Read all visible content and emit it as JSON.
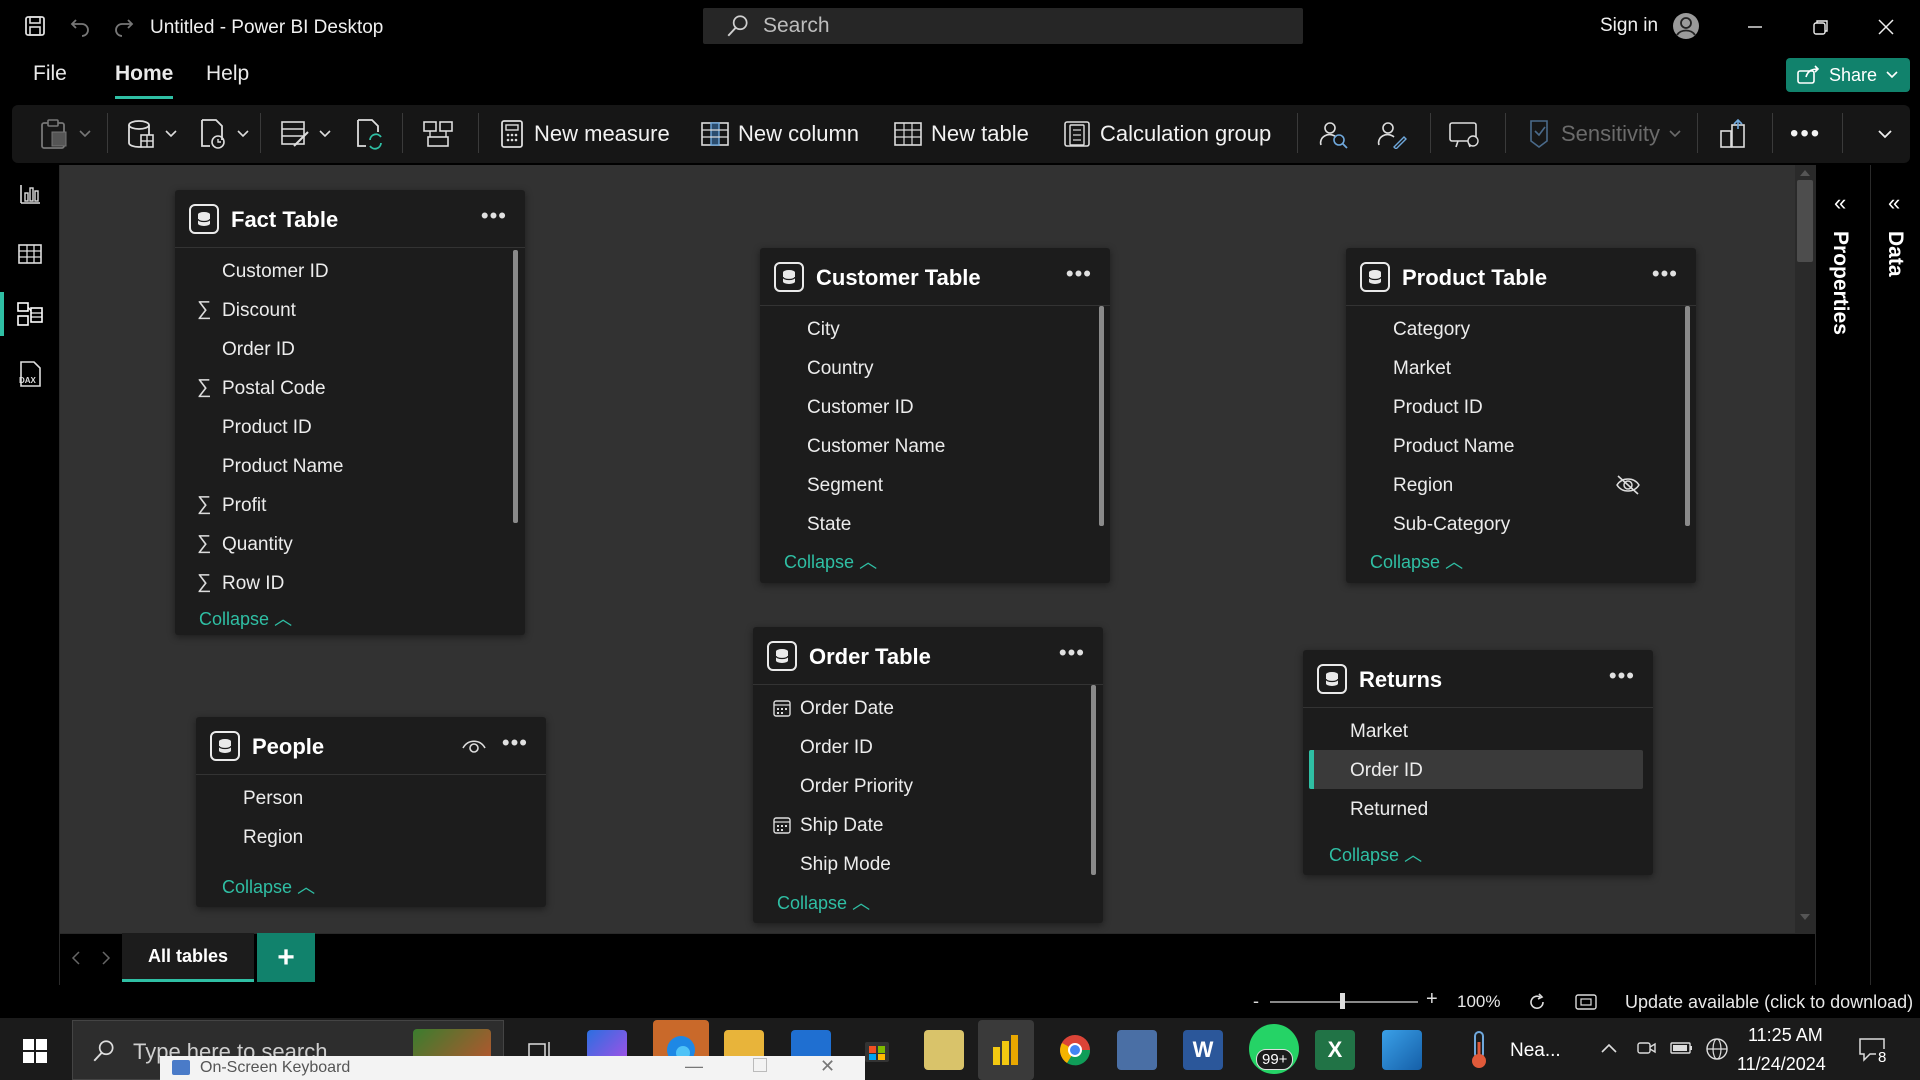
{
  "titlebar": {
    "title": "Untitled - Power BI Desktop",
    "search_placeholder": "Search",
    "sign_in": "Sign in"
  },
  "menu": {
    "file": "File",
    "home": "Home",
    "help": "Help",
    "share": "Share"
  },
  "ribbon": {
    "new_measure": "New measure",
    "new_column": "New column",
    "new_table": "New table",
    "calculation_group": "Calculation group",
    "sensitivity": "Sensitivity"
  },
  "right_panes": {
    "properties": "Properties",
    "data": "Data"
  },
  "tables": {
    "fact": {
      "title": "Fact Table",
      "fields": [
        {
          "name": "Customer ID",
          "sum": false
        },
        {
          "name": "Discount",
          "sum": true
        },
        {
          "name": "Order ID",
          "sum": false
        },
        {
          "name": "Postal Code",
          "sum": true
        },
        {
          "name": "Product ID",
          "sum": false
        },
        {
          "name": "Product Name",
          "sum": false
        },
        {
          "name": "Profit",
          "sum": true
        },
        {
          "name": "Quantity",
          "sum": true
        },
        {
          "name": "Row ID",
          "sum": true
        }
      ],
      "collapse": "Collapse"
    },
    "customer": {
      "title": "Customer Table",
      "fields": [
        "City",
        "Country",
        "Customer ID",
        "Customer Name",
        "Segment",
        "State"
      ],
      "collapse": "Collapse"
    },
    "product": {
      "title": "Product Table",
      "fields": [
        "Category",
        "Market",
        "Product ID",
        "Product Name",
        "Region",
        "Sub-Category"
      ],
      "hidden_field": "Region",
      "collapse": "Collapse"
    },
    "people": {
      "title": "People",
      "fields": [
        "Person",
        "Region"
      ],
      "collapse": "Collapse"
    },
    "order": {
      "title": "Order Table",
      "fields": [
        {
          "name": "Order Date",
          "date": true
        },
        {
          "name": "Order ID",
          "date": false
        },
        {
          "name": "Order Priority",
          "date": false
        },
        {
          "name": "Ship Date",
          "date": true
        },
        {
          "name": "Ship Mode",
          "date": false
        }
      ],
      "collapse": "Collapse"
    },
    "returns": {
      "title": "Returns",
      "fields": [
        "Market",
        "Order ID",
        "Returned"
      ],
      "selected_field": "Order ID",
      "collapse": "Collapse"
    }
  },
  "tabs": {
    "all_tables": "All tables",
    "add": "+"
  },
  "status": {
    "zoom": "100%",
    "update": "Update available (click to download)"
  },
  "taskbar": {
    "search_placeholder": "Type here to search",
    "osk_title": "On-Screen Keyboard",
    "weather": "Nea...",
    "time": "11:25 AM",
    "date": "11/24/2024",
    "whatsapp_badge": "99+",
    "notification_count": "8"
  },
  "colors": {
    "accent": "#2fbfa4",
    "share_bg": "#11826c",
    "canvas": "#323232",
    "card": "#1c1c1c"
  },
  "icons": [
    "save-icon",
    "undo-icon",
    "redo-icon",
    "search-icon",
    "user-icon",
    "minimize-icon",
    "restore-icon",
    "close-icon",
    "share-icon",
    "paste-icon",
    "data-icon",
    "transform-icon",
    "dataset-icon",
    "refresh-icon",
    "manage-relationships-icon",
    "calculator-icon",
    "grid-icon",
    "view-roles-icon",
    "manage-roles-icon",
    "q-and-a-icon",
    "sensitivity-icon",
    "publish-icon",
    "more-icon",
    "report-view-icon",
    "table-view-icon",
    "model-view-icon",
    "dax-query-icon",
    "sigma-icon",
    "calendar-icon",
    "hidden-eye-icon",
    "eye-icon",
    "windows-icon"
  ]
}
